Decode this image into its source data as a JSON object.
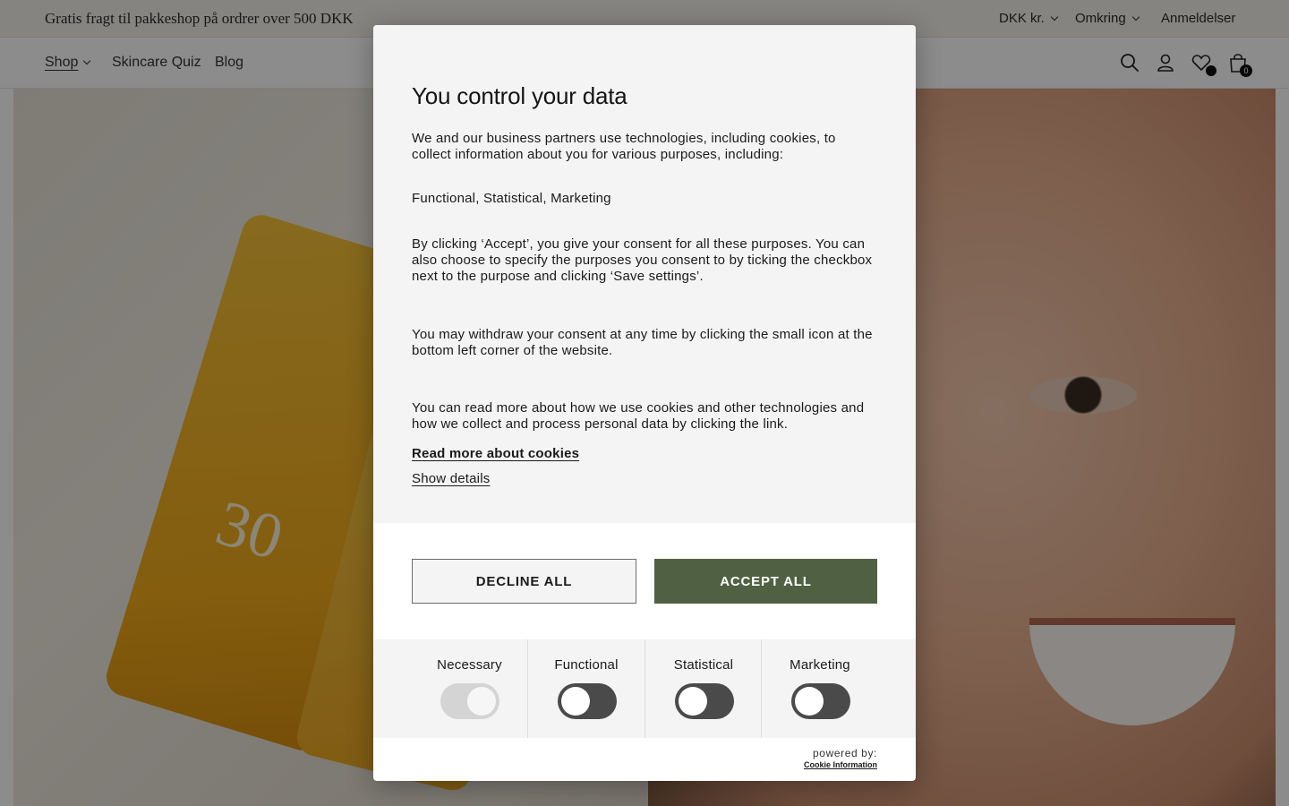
{
  "announcement": {
    "text": "Gratis fragt til pakkeshop på ordrer over 500 DKK"
  },
  "utility_nav": {
    "currency": "DKK kr.",
    "about": "Omkring",
    "reviews": "Anmeldelser"
  },
  "main_nav": {
    "items": [
      {
        "label": "Shop"
      },
      {
        "label": "Skincare Quiz"
      },
      {
        "label": "Blog"
      }
    ],
    "cart_count": "0"
  },
  "hero": {
    "product_number": "30"
  },
  "consent": {
    "title": "You control your data",
    "intro": "We and our business partners use technologies, including cookies, to collect information about you for various purposes, including:",
    "purposes": "Functional, Statistical, Marketing",
    "consent_text": "By clicking ‘Accept’, you give your consent for all these purposes. You can also choose to specify the purposes you consent to by ticking the checkbox next to the purpose and clicking ‘Save settings’.",
    "withdraw_text": "You may withdraw your consent at any time by clicking the small icon at the bottom left corner of the website.",
    "read_more_text": "You can read more about how we use cookies and other technologies and how we collect and process personal data by clicking the link.",
    "read_more_link": "Read more about cookies",
    "show_details": "Show details",
    "decline_label": "DECLINE ALL",
    "accept_label": "ACCEPT ALL",
    "categories": [
      {
        "label": "Necessary",
        "enabled": true
      },
      {
        "label": "Functional",
        "enabled": false
      },
      {
        "label": "Statistical",
        "enabled": false
      },
      {
        "label": "Marketing",
        "enabled": false
      }
    ],
    "powered_by": "powered by:",
    "powered_brand": "Cookie Information"
  },
  "colors": {
    "accept": "#4f6043",
    "toggle_off": "#4a4a4a",
    "toggle_on_disabled": "#d4d4d4"
  }
}
